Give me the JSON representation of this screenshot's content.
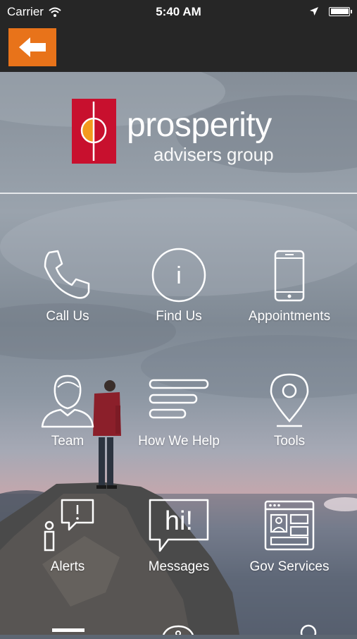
{
  "status_bar": {
    "carrier": "Carrier",
    "time": "5:40 AM"
  },
  "nav": {
    "back_icon": "arrow-left-icon",
    "accent_color": "#e8731a"
  },
  "brand": {
    "name": "prosperity",
    "subtitle": "advisers group",
    "mark_color": "#c8102e",
    "mark_accent": "#f39a1e"
  },
  "menu": [
    {
      "label": "Call Us",
      "icon": "phone-icon"
    },
    {
      "label": "Find Us",
      "icon": "info-icon"
    },
    {
      "label": "Appointments",
      "icon": "smartphone-icon"
    },
    {
      "label": "Team",
      "icon": "person-icon"
    },
    {
      "label": "How We Help",
      "icon": "lines-icon"
    },
    {
      "label": "Tools",
      "icon": "map-pin-icon"
    },
    {
      "label": "Alerts",
      "icon": "alert-icon"
    },
    {
      "label": "Messages",
      "icon": "chat-hi-icon"
    },
    {
      "label": "Gov Services",
      "icon": "browser-window-icon"
    }
  ],
  "menu_hi_text": "hi!"
}
